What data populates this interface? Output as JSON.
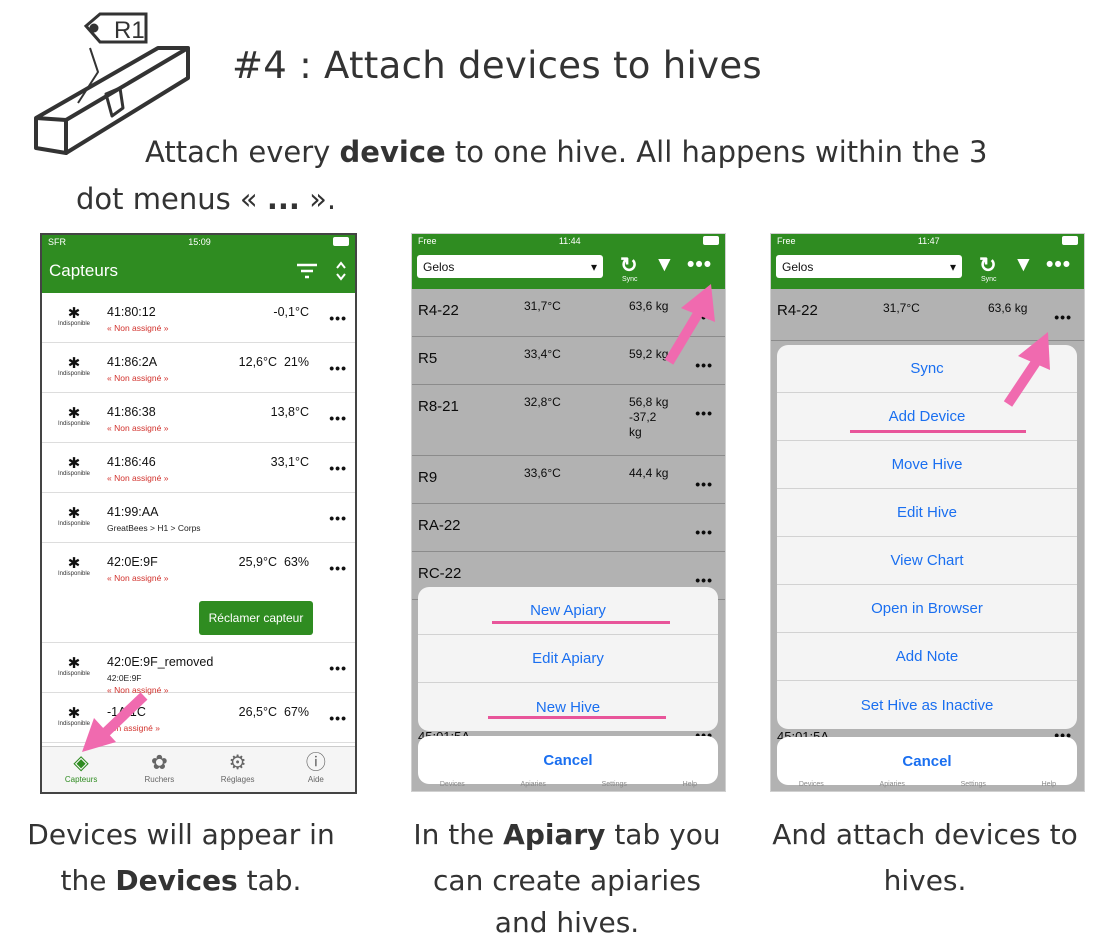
{
  "title": "#4 : Attach devices to hives",
  "intro": {
    "line1_pre": "Attach every ",
    "line1_bold": "device",
    "line1_post": "  to one hive.  All happens within the 3",
    "line2_pre": "dot menus « ",
    "line2_bold": "...",
    "line2_post": " »."
  },
  "logo_label": "R1",
  "captions": [
    {
      "pre": "Devices will appear in",
      "line2_pre": "the ",
      "bold": "Devices",
      "post": " tab."
    },
    {
      "pre": "In the ",
      "bold": "Apiary",
      "post": " tab you",
      "line2": "can create apiaries",
      "line3": "and hives."
    },
    {
      "line1": "And attach devices to",
      "line2": "hives."
    }
  ],
  "phone1": {
    "status": {
      "carrier": "SFR",
      "time": "15:09"
    },
    "nav_title": "Capteurs",
    "filter_icon": "filter-lines-icon",
    "sort_icon": "chevron-updown-icon",
    "rows": [
      {
        "mac": "41:80:12",
        "sub": "« Non assigné »",
        "vals": "-0,1°C",
        "status": "indisponible",
        "assigned": false
      },
      {
        "mac": "41:86:2A",
        "sub": "« Non assigné »",
        "vals": "12,6°C  21%",
        "status": "indisponible",
        "assigned": false
      },
      {
        "mac": "41:86:38",
        "sub": "« Non assigné »",
        "vals": "13,8°C",
        "status": "indisponible",
        "assigned": false
      },
      {
        "mac": "41:86:46",
        "sub": "« Non assigné »",
        "vals": "33,1°C",
        "status": "indisponible",
        "assigned": false
      },
      {
        "mac": "41:99:AA",
        "sub": "GreatBees > H1 > Corps",
        "vals": "",
        "status": "indisponible",
        "assigned": true
      },
      {
        "mac": "42:0E:9F",
        "sub": "« Non assigné »",
        "vals": "25,9°C  63%",
        "status": "indisponible",
        "assigned": false
      },
      {
        "mac": "42:0E:9F_removed",
        "sub2": "42:0E:9F",
        "sub": "« Non assigné »",
        "vals": "",
        "status": "indisponible",
        "assigned": false
      },
      {
        "mac": "-1A:1C",
        "sub": "non assigné »",
        "vals": "26,5°C  67%",
        "status": "indisponible",
        "assigned": false
      }
    ],
    "claim_button": "Réclamer capteur",
    "tabs": [
      {
        "label": "Capteurs",
        "icon": "diamond-sensor-icon"
      },
      {
        "label": "Ruchers",
        "icon": "apiary-icon"
      },
      {
        "label": "Réglages",
        "icon": "gear-icon"
      },
      {
        "label": "Aide",
        "icon": "help-icon"
      }
    ]
  },
  "phone2": {
    "status": {
      "carrier": "Free",
      "time": "11:44"
    },
    "apiary": "Gelos",
    "sync_label": "Sync",
    "hives": [
      {
        "name": "R4-22",
        "temp": "31,7°C",
        "weight": "63,6 kg"
      },
      {
        "name": "R5",
        "temp": "33,4°C",
        "weight": "59,2 kg"
      },
      {
        "name": "R8-21",
        "temp": "32,8°C",
        "weight": "56,8 kg\n-37,2\nkg"
      },
      {
        "name": "R9",
        "temp": "33,6°C",
        "weight": "44,4 kg"
      },
      {
        "name": "RA-22",
        "temp": "",
        "weight": ""
      },
      {
        "name": "RC-22",
        "temp": "",
        "weight": ""
      }
    ],
    "partial_row": "45:01:5A",
    "menu": [
      "New Apiary",
      "Edit Apiary",
      "New Hive"
    ],
    "cancel": "Cancel",
    "tabs": [
      "Devices",
      "Apiaries",
      "Settings",
      "Help"
    ]
  },
  "phone3": {
    "status": {
      "carrier": "Free",
      "time": "11:47"
    },
    "apiary": "Gelos",
    "sync_label": "Sync",
    "hive": {
      "name": "R4-22",
      "temp": "31,7°C",
      "weight": "63,6 kg"
    },
    "partial_row": "45:01:5A",
    "menu": [
      "Sync",
      "Add Device",
      "Move Hive",
      "Edit Hive",
      "View Chart",
      "Open in Browser",
      "Add Note",
      "Set Hive as Inactive"
    ],
    "cancel": "Cancel",
    "tabs": [
      "Devices",
      "Apiaries",
      "Settings",
      "Help"
    ]
  },
  "colors": {
    "app_green": "#2f8c21",
    "highlight_pink": "#e8559a",
    "ios_blue": "#1a6ff0",
    "unassigned_red": "#d2322d"
  }
}
